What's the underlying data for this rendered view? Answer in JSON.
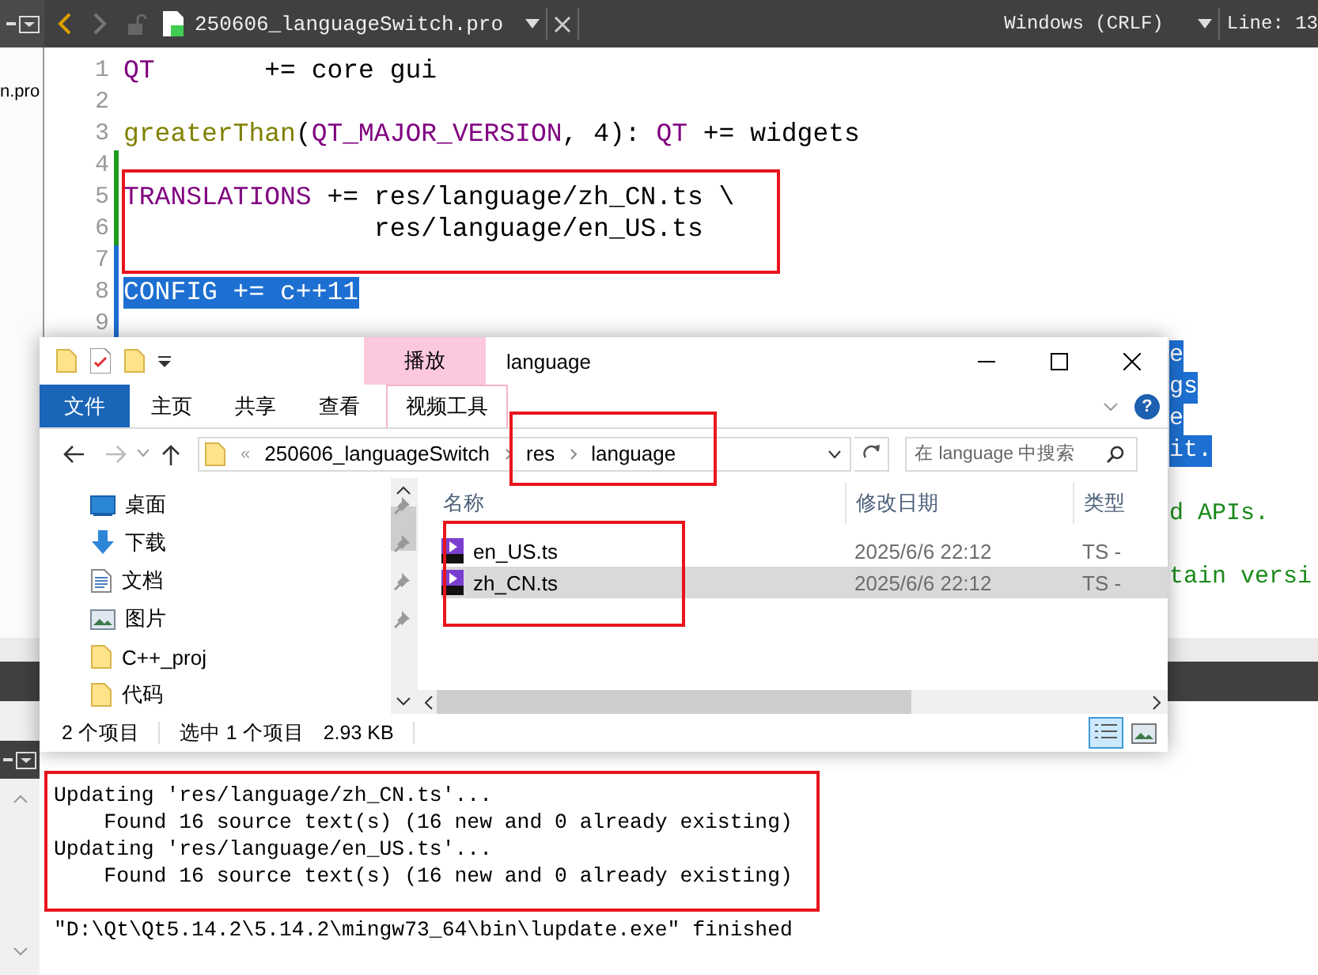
{
  "editor_tab": {
    "file_name": "250606_languageSwitch.pro",
    "line_ending": "Windows (CRLF)",
    "position": "Line: 13"
  },
  "sidebar": {
    "items": [
      "n.pro"
    ]
  },
  "code_lines": [
    {
      "number": "1",
      "modified": false,
      "selected": false,
      "tokens": [
        {
          "text": "QT",
          "kind": "keyword"
        },
        {
          "text": "       += core gui",
          "kind": "plain"
        }
      ]
    },
    {
      "number": "2",
      "modified": false,
      "selected": false
    },
    {
      "number": "3",
      "modified": false,
      "selected": false,
      "tokens": [
        {
          "text": "greaterThan",
          "kind": "function"
        },
        {
          "text": "(",
          "kind": "plain"
        },
        {
          "text": "QT_MAJOR_VERSION",
          "kind": "keyword"
        },
        {
          "text": ", 4): ",
          "kind": "plain"
        },
        {
          "text": "QT",
          "kind": "keyword"
        },
        {
          "text": " += widgets",
          "kind": "plain"
        }
      ]
    },
    {
      "number": "4",
      "modified": true,
      "selected": false
    },
    {
      "number": "5",
      "modified": true,
      "selected": false,
      "tokens": [
        {
          "text": "TRANSLATIONS",
          "kind": "keyword"
        },
        {
          "text": " += res/language/zh_CN.ts \\",
          "kind": "plain"
        }
      ]
    },
    {
      "number": "6",
      "modified": true,
      "selected": false,
      "tokens": [
        {
          "text": "                res/language/en_US.ts",
          "kind": "plain"
        }
      ]
    },
    {
      "number": "7",
      "modified": false,
      "selected": true
    },
    {
      "number": "8",
      "modified": false,
      "selected": true,
      "tokens": [
        {
          "text": "CONFIG += c++11",
          "kind": "plain"
        }
      ]
    },
    {
      "number": "9",
      "modified": false,
      "selected": true
    }
  ],
  "line_tails": [
    {
      "kind": "selected",
      "text": "e"
    },
    {
      "kind": "selected",
      "text": "gs"
    },
    {
      "kind": "selected",
      "text": "e"
    },
    {
      "kind": "selected",
      "text": "it."
    },
    {
      "kind": "blank"
    },
    {
      "kind": "comment",
      "text": "d APIs."
    },
    {
      "kind": "blank"
    },
    {
      "kind": "comment",
      "text": "tain versi"
    }
  ],
  "editor_highlight_box": true,
  "explorer": {
    "title": "language",
    "context_tab": "播放",
    "ribbon_tabs": [
      {
        "label": "文件",
        "kind": "file"
      },
      {
        "label": "主页",
        "kind": "normal"
      },
      {
        "label": "共享",
        "kind": "normal"
      },
      {
        "label": "查看",
        "kind": "normal"
      },
      {
        "label": "视频工具",
        "kind": "context"
      }
    ],
    "help_glyph": "?",
    "address": {
      "overflow": "«",
      "crumbs": [
        "250606_languageSwitch",
        "res",
        "language"
      ],
      "highlight_box": true
    },
    "search": {
      "placeholder": "在 language 中搜索"
    },
    "nav_items": [
      {
        "label": "桌面",
        "kind": "desktop",
        "pinned": true
      },
      {
        "label": "下载",
        "kind": "download",
        "pinned": true
      },
      {
        "label": "文档",
        "kind": "document",
        "pinned": true
      },
      {
        "label": "图片",
        "kind": "pictures",
        "pinned": true
      },
      {
        "label": "C++_proj",
        "kind": "folder",
        "pinned": false
      },
      {
        "label": "代码",
        "kind": "folder",
        "pinned": false
      }
    ],
    "columns": [
      "名称",
      "修改日期",
      "类型"
    ],
    "files": [
      {
        "name": "en_US.ts",
        "modified": "2025/6/6 22:12",
        "type": "TS - ",
        "selected": false
      },
      {
        "name": "zh_CN.ts",
        "modified": "2025/6/6 22:12",
        "type": "TS - ",
        "selected": true
      }
    ],
    "files_highlight_box": true,
    "status": {
      "item_count": "2 个项目",
      "selection": "选中 1 个项目",
      "size": "2.93 KB"
    },
    "views": [
      {
        "kind": "details",
        "selected": true
      },
      {
        "kind": "large-icons",
        "selected": false
      }
    ]
  },
  "output": {
    "lines": [
      {
        "text": "Updating 'res/language/zh_CN.ts'...",
        "kind": "block"
      },
      {
        "text": "    Found 16 source text(s) (16 new and 0 already existing)",
        "kind": "block"
      },
      {
        "text": "Updating 'res/language/en_US.ts'...",
        "kind": "block"
      },
      {
        "text": "    Found 16 source text(s) (16 new and 0 already existing)",
        "kind": "block"
      },
      {
        "text": "\"D:\\Qt\\Qt5.14.2\\5.14.2\\mingw73_64\\bin\\lupdate.exe\" finished",
        "kind": "status"
      }
    ],
    "highlight_box": true
  }
}
